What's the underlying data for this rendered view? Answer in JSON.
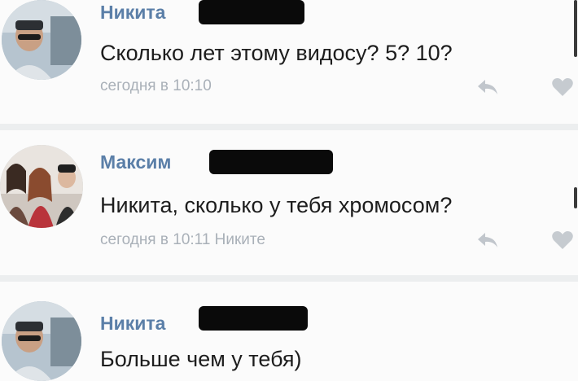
{
  "comments": [
    {
      "author": "Никита",
      "text": "Сколько лет этому видосу? 5? 10?",
      "meta": "сегодня в 10:10",
      "avatar_icon": "user-photo-icon"
    },
    {
      "author": "Максим",
      "text": "Никита, сколько у тебя хромосом?",
      "meta": "сегодня в 10:11 Никите",
      "avatar_icon": "group-photo-icon"
    },
    {
      "author": "Никита",
      "text": "Больше чем у тебя)",
      "meta": "",
      "avatar_icon": "user-photo-icon"
    }
  ],
  "icons": {
    "reply": "reply-arrow-icon",
    "like": "heart-icon"
  },
  "colors": {
    "author": "#5b7fa8",
    "text": "#1d1d1d",
    "meta": "#a9b0b8",
    "redaction": "#0a0a0a"
  }
}
